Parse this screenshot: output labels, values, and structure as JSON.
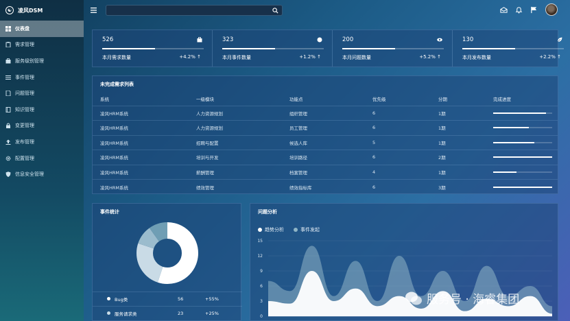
{
  "brand": {
    "logo_text": "☯",
    "name": "凌风DSM"
  },
  "sidebar": {
    "items": [
      {
        "label": "仪表盘",
        "icon": "dashboard-icon",
        "active": true
      },
      {
        "label": "需求管理",
        "icon": "clipboard-icon"
      },
      {
        "label": "服务级别管理",
        "icon": "briefcase-icon"
      },
      {
        "label": "事件管理",
        "icon": "list-icon"
      },
      {
        "label": "问题管理",
        "icon": "document-icon"
      },
      {
        "label": "知识管理",
        "icon": "book-icon"
      },
      {
        "label": "变更管理",
        "icon": "lock-icon"
      },
      {
        "label": "发布管理",
        "icon": "upload-icon"
      },
      {
        "label": "配置管理",
        "icon": "gear-icon"
      },
      {
        "label": "信息安全管理",
        "icon": "shield-icon"
      }
    ]
  },
  "search": {
    "placeholder": ""
  },
  "stats": [
    {
      "value": "526",
      "label": "本月需求数量",
      "change": "+4.2%",
      "icon": "briefcase-icon",
      "progress": 0.52
    },
    {
      "value": "323",
      "label": "本月事件数量",
      "change": "+1.2%",
      "icon": "circle-icon",
      "progress": 0.52
    },
    {
      "value": "200",
      "label": "本月问题数量",
      "change": "+5.2%",
      "icon": "eye-icon",
      "progress": 0.52
    },
    {
      "value": "130",
      "label": "本月发布数量",
      "change": "+2.2%",
      "icon": "leaf-icon",
      "progress": 0.52
    }
  ],
  "table": {
    "title": "未完成需求列表",
    "headers": [
      "系统",
      "一级模块",
      "功能点",
      "优先级",
      "分期",
      "完成进度"
    ],
    "rows": [
      {
        "system": "凌风HRM系统",
        "module": "人力资源规划",
        "feature": "组织管理",
        "priority": "6",
        "phase": "1期",
        "progress": 0.9
      },
      {
        "system": "凌风HRM系统",
        "module": "人力资源规划",
        "feature": "员工管理",
        "priority": "6",
        "phase": "1期",
        "progress": 0.6
      },
      {
        "system": "凌风HRM系统",
        "module": "招聘与配置",
        "feature": "候选人库",
        "priority": "5",
        "phase": "1期",
        "progress": 0.7
      },
      {
        "system": "凌风HRM系统",
        "module": "培训与开发",
        "feature": "培训路径",
        "priority": "6",
        "phase": "2期",
        "progress": 1.0
      },
      {
        "system": "凌风HRM系统",
        "module": "薪酬管理",
        "feature": "档案管理",
        "priority": "4",
        "phase": "1期",
        "progress": 0.4
      },
      {
        "system": "凌风HRM系统",
        "module": "绩效管理",
        "feature": "绩效指标库",
        "priority": "6",
        "phase": "3期",
        "progress": 1.0
      }
    ]
  },
  "events": {
    "title": "事件统计",
    "items": [
      {
        "name": "Bug类",
        "count": "56",
        "change": "+55%",
        "color": "#ffffff",
        "share": 0.55
      },
      {
        "name": "服务请求类",
        "count": "23",
        "change": "+25%",
        "color": "#c9dbe6",
        "share": 0.25
      },
      {
        "name": "",
        "count": "",
        "change": "",
        "color": "#9bbccd",
        "share": 0.1
      },
      {
        "name": "",
        "count": "",
        "change": "",
        "color": "#6f9eb4",
        "share": 0.1
      }
    ]
  },
  "issues": {
    "title": "问题分析",
    "chart_data": {
      "type": "area",
      "series": [
        {
          "name": "趋势分析",
          "color": "#ffffff",
          "values": [
            3,
            2.5,
            9,
            3,
            5.5,
            2,
            4,
            1.5,
            5,
            1,
            3.5,
            2,
            4,
            0.5
          ]
        },
        {
          "name": "事件发起",
          "color": "#8fb5c6",
          "values": [
            7,
            5,
            14,
            4,
            11,
            3,
            12,
            4,
            9,
            3,
            10,
            4,
            6,
            2
          ]
        }
      ],
      "ylim": [
        0,
        15
      ],
      "yticks": [
        "15",
        "12",
        "9",
        "6",
        "3",
        "0"
      ],
      "xlabel": "",
      "ylabel": ""
    }
  },
  "watermark": {
    "text": "服务号 · 海睿集团"
  }
}
